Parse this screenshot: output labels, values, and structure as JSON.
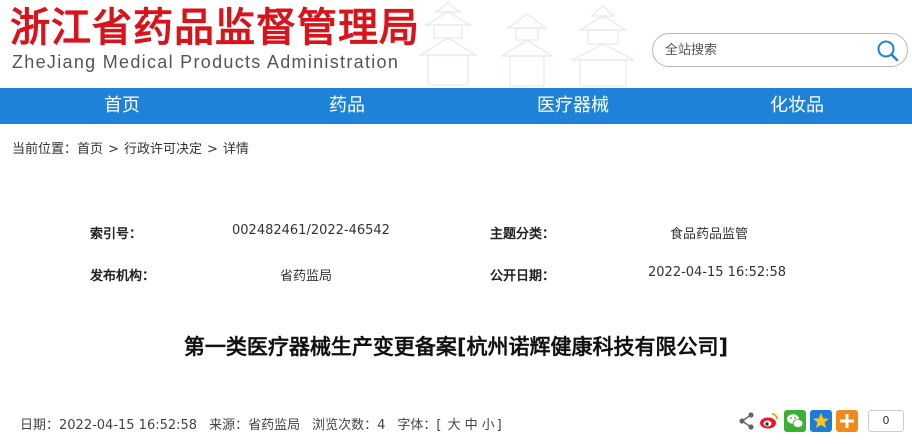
{
  "header": {
    "logo_cn": "浙江省药品监督管理局",
    "logo_en": "ZheJiang Medical Products Administration"
  },
  "search": {
    "placeholder": "全站搜索",
    "icon": "search-icon"
  },
  "nav": {
    "items": [
      {
        "label": "首页"
      },
      {
        "label": "药品"
      },
      {
        "label": "医疗器械"
      },
      {
        "label": "化妆品"
      }
    ]
  },
  "breadcrumb": {
    "prefix": "当前位置：",
    "items": [
      "首页",
      "行政许可决定",
      "详情"
    ],
    "separator": ">"
  },
  "meta": {
    "index_label": "索引号：",
    "index_value": "002482461/2022-46542",
    "category_label": "主题分类：",
    "category_value": "食品药品监管",
    "publisher_label": "发布机构：",
    "publisher_value": "省药监局",
    "pubdate_label": "公开日期：",
    "pubdate_value": "2022-04-15 16:52:58"
  },
  "article": {
    "title": "第一类医疗器械生产变更备案[杭州诺辉健康科技有限公司]",
    "date": "日期：2022-04-15 16:52:58",
    "source": "来源：省药监局",
    "views": "浏览次数：4",
    "font_label": "字体：[",
    "font_large": "大",
    "font_medium": "中",
    "font_small": "小",
    "font_close": "]"
  },
  "share": {
    "icons": [
      "share-icon",
      "weibo-icon",
      "wechat-icon",
      "qzone-icon",
      "more-share-icon"
    ],
    "count": "0"
  },
  "colors": {
    "brand_red": "#d7141b",
    "nav_blue": "#1f82d9"
  }
}
